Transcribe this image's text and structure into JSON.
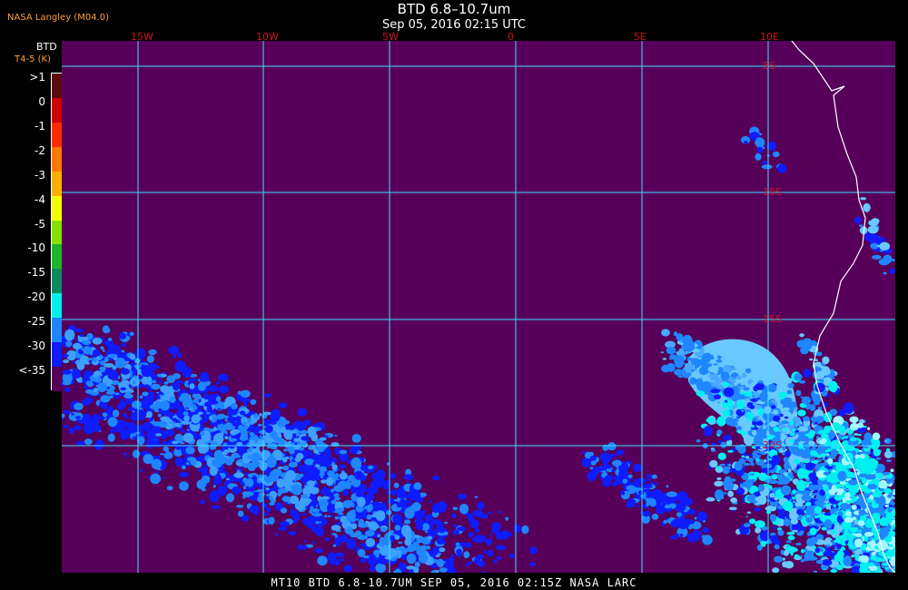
{
  "header": {
    "title": "BTD 6.8–10.7um",
    "subtitle": "Sep 05, 2016 02:15 UTC",
    "provider": "NASA Langley (M04.0)"
  },
  "legend": {
    "title": "BTD",
    "units": "T4-5 (K)",
    "entries": [
      {
        "label": ">1",
        "color": "#5a0a0a"
      },
      {
        "label": "0",
        "color": "#d00000"
      },
      {
        "label": "-1",
        "color": "#ff2a00"
      },
      {
        "label": "-2",
        "color": "#ff7a00"
      },
      {
        "label": "-3",
        "color": "#ffb000"
      },
      {
        "label": "-4",
        "color": "#f2ff00"
      },
      {
        "label": "-5",
        "color": "#86e000"
      },
      {
        "label": "-10",
        "color": "#1fb52a"
      },
      {
        "label": "-15",
        "color": "#0f8a60"
      },
      {
        "label": "-20",
        "color": "#00f0f0"
      },
      {
        "label": "-25",
        "color": "#1f86ff"
      },
      {
        "label": "-30",
        "color": "#0e1cff"
      },
      {
        "label": "<-35",
        "color": "#56005a"
      }
    ]
  },
  "map": {
    "background": "#56005a",
    "grid_color": "#3fe0ff",
    "lon_labels": [
      "15W",
      "10W",
      "5W",
      "0",
      "5E",
      "10E"
    ],
    "lat_labels": [
      "5S",
      "10S",
      "15S",
      "20S"
    ]
  },
  "footer": {
    "text": "MT10  BTD 6.8-10.7UM   SEP 05, 2016 02:15Z   NASA LARC"
  }
}
